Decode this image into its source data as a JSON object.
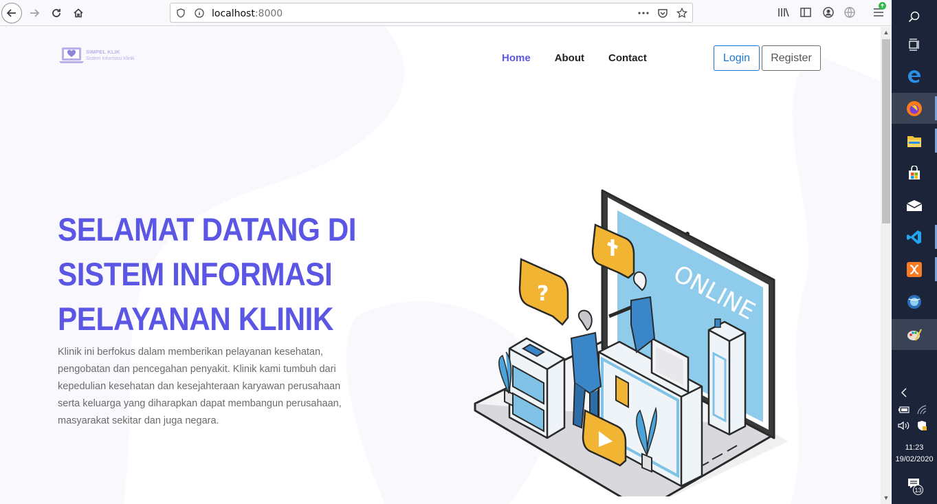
{
  "browser": {
    "url_host": "localhost",
    "url_port": ":8000"
  },
  "site": {
    "logo_title": "SIMPEL KLIK",
    "logo_subtitle": "Sistem Informasi Klinik",
    "nav": [
      {
        "label": "Home",
        "active": true
      },
      {
        "label": "About",
        "active": false
      },
      {
        "label": "Contact",
        "active": false
      }
    ],
    "login_label": "Login",
    "register_label": "Register",
    "hero_line1": "SELAMAT DATANG DI",
    "hero_line2": "SISTEM INFORMASI",
    "hero_line3": "PELAYANAN KLINIK",
    "hero_description": "Klinik ini berfokus dalam memberikan pelayanan kesehatan, pengobatan dan pencegahan penyakit. Klinik kami tumbuh dari kepedulian kesehatan dan kesejahteraan karyawan perusahaan serta keluarga yang diharapkan dapat membangun perusahaan, masyarakat sekitar dan juga negara.",
    "illustration_screen_text": "ONLINE"
  },
  "colors": {
    "accent": "#5b57e4",
    "login_blue": "#1c74d2",
    "taskbar": "#1b2438"
  },
  "taskbar": {
    "time": "11:23",
    "date": "19/02/2020",
    "notification_count": "13",
    "apps": [
      "search-icon",
      "task-view-icon",
      "edge-icon",
      "firefox-icon",
      "file-explorer-icon",
      "store-icon",
      "mail-icon",
      "vscode-icon",
      "xampp-icon",
      "network-globe-icon",
      "paint-icon"
    ]
  }
}
